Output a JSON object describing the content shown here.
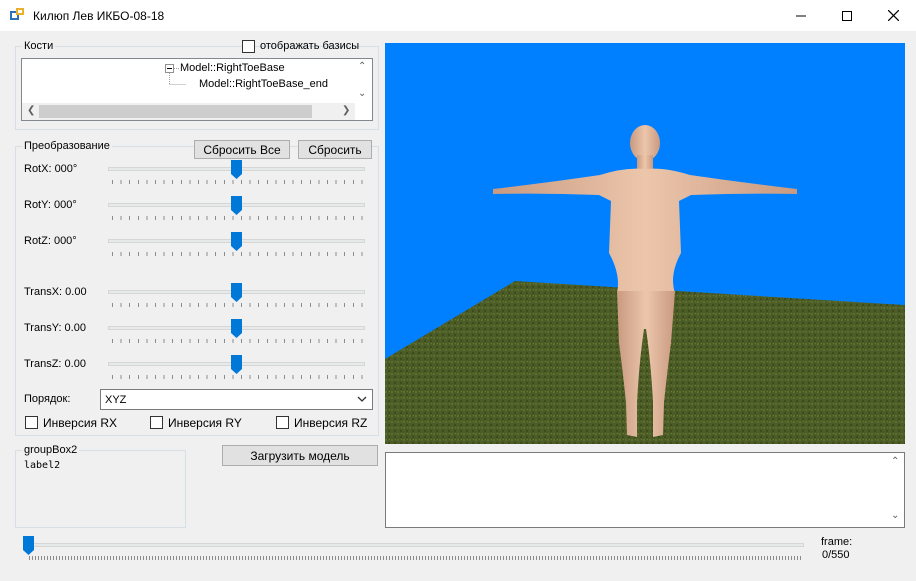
{
  "window": {
    "title": "Килюп Лев ИКБО-08-18"
  },
  "bones": {
    "group_title": "Кости",
    "show_bases_label": "отображать базисы",
    "tree": [
      {
        "label": "Model::RightToeBase"
      },
      {
        "label": "Model::RightToeBase_end"
      }
    ]
  },
  "transform": {
    "group_title": "Преобразование",
    "reset_all_label": "Сбросить Все",
    "reset_label": "Сбросить",
    "sliders": [
      {
        "label": "RotX:  000°",
        "value": 0.5
      },
      {
        "label": "RotY:  000°",
        "value": 0.5
      },
      {
        "label": "RotZ:  000°",
        "value": 0.5
      },
      {
        "label": "TransX: 0.00",
        "value": 0.5
      },
      {
        "label": "TransY: 0.00",
        "value": 0.5
      },
      {
        "label": "TransZ: 0.00",
        "value": 0.5
      }
    ],
    "order_label": "Порядок:",
    "order_value": "XYZ",
    "inversions": [
      {
        "label": "Инверсия RX"
      },
      {
        "label": "Инверсия RY"
      },
      {
        "label": "Инверсия RZ"
      }
    ]
  },
  "groupbox2": {
    "title": "groupBox2",
    "label": "label2"
  },
  "load_model_label": "Загрузить модель",
  "timeline": {
    "frame_title": "frame:",
    "frame_value": "0/550",
    "current": 0,
    "total": 550
  },
  "colors": {
    "sky": "#0080ff",
    "ground": "#4a5a24",
    "slider_thumb": "#0078d7",
    "skin": "#e2b99c"
  }
}
